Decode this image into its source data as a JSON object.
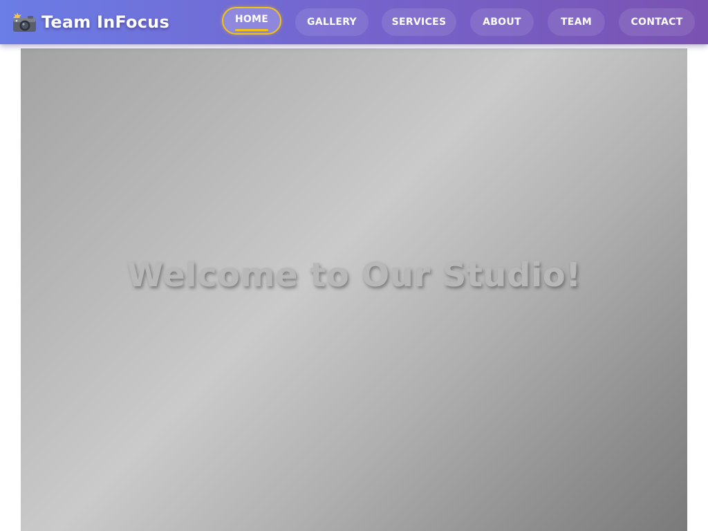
{
  "brand": {
    "icon": "camera-flash-icon",
    "name": "Team InFocus"
  },
  "nav": {
    "items": [
      {
        "label": "HOME",
        "active": true
      },
      {
        "label": "GALLERY",
        "active": false
      },
      {
        "label": "SERVICES",
        "active": false
      },
      {
        "label": "ABOUT",
        "active": false
      },
      {
        "label": "TEAM",
        "active": false
      },
      {
        "label": "CONTACT",
        "active": false
      }
    ]
  },
  "hero": {
    "title": "Welcome to Our Studio!"
  },
  "colors": {
    "nav_gradient_start": "#6b7de6",
    "nav_gradient_end": "#7a52b2",
    "active_accent": "#f2c414",
    "hero_gray": "#b8b8b8"
  }
}
